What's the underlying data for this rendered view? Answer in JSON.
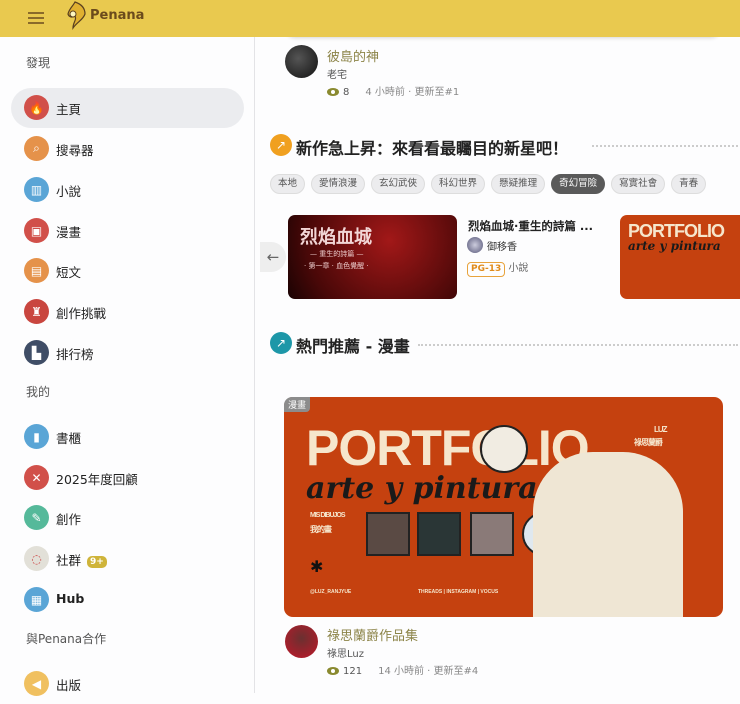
{
  "header": {
    "brand": "Penana"
  },
  "sidebar": {
    "sections": [
      {
        "label": "發現",
        "items": [
          {
            "label": "主頁",
            "icon": "fire-icon",
            "color": "#d1504a"
          },
          {
            "label": "搜尋器",
            "icon": "search-icon",
            "color": "#e5924a"
          },
          {
            "label": "小說",
            "icon": "books-icon",
            "color": "#5aa5d6"
          },
          {
            "label": "漫畫",
            "icon": "comic-icon",
            "color": "#d1504a"
          },
          {
            "label": "短文",
            "icon": "document-icon",
            "color": "#e5924a"
          },
          {
            "label": "創作挑戰",
            "icon": "trophy-icon",
            "color": "#c9463f"
          },
          {
            "label": "排行榜",
            "icon": "ranking-icon",
            "color": "#3f4d66"
          }
        ]
      },
      {
        "label": "我的",
        "items": [
          {
            "label": "書櫃",
            "icon": "bookshelf-icon",
            "color": "#5aa5d6"
          },
          {
            "label": "2025年度回顧",
            "icon": "review-icon",
            "color": "#d1504a"
          },
          {
            "label": "創作",
            "icon": "write-icon",
            "color": "#55b99a"
          },
          {
            "label": "社群",
            "icon": "community-icon",
            "color": "#e2e0d8",
            "badge": "9+"
          },
          {
            "label": "Hub",
            "icon": "hub-icon",
            "color": "#5aa5d6"
          }
        ]
      },
      {
        "label": "與Penana合作",
        "items": [
          {
            "label": "出版",
            "icon": "megaphone-icon",
            "color": "#f0c060"
          }
        ]
      }
    ]
  },
  "top_story": {
    "title": "彼島的神",
    "author": "老宅",
    "views": "8",
    "updated": "4 小時前 · 更新至#1"
  },
  "rising": {
    "heading": "新作急上昇：來看看最矚目的新星吧！",
    "chips": [
      "本地",
      "愛情浪漫",
      "玄幻武俠",
      "科幻世界",
      "懸疑推理",
      "奇幻冒險",
      "寫實社會",
      "青春"
    ],
    "selected_chip": "奇幻冒險",
    "card": {
      "title": "烈焰血城·重生的詩篇 ...",
      "author": "御移香",
      "rating": "PG-13",
      "type": "小說",
      "cover_title": "烈焰血城",
      "cover_sub": "— 重生的詩篇 —",
      "cover_chapter": "· 第一章 · 血色覺醒 ·"
    }
  },
  "hot": {
    "heading": "熱門推薦 - 漫畫",
    "tag": "漫畫",
    "cover": {
      "title": "PORTFOLIO",
      "script": "arte y pintura",
      "side": "LUZ",
      "side2": "祿思蘭爵",
      "mis": "MIS DIBUJOS",
      "mine": "我的畫",
      "handle": "@LUZ_RANJYUE",
      "links": "THREADS | INSTAGRAM | VOCUS"
    },
    "story": {
      "title": "祿思蘭爵作品集",
      "author": "祿思Luz",
      "views": "121",
      "updated": "14 小時前 · 更新至#4"
    }
  },
  "colors": {
    "header": "#e9c94f",
    "title": "#8c8448"
  }
}
